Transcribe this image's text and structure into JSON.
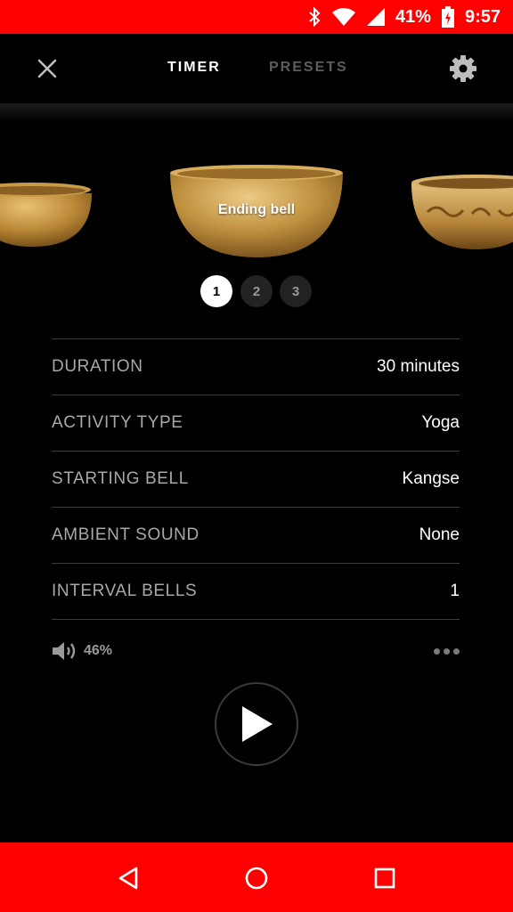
{
  "status_bar": {
    "battery_percent": "41%",
    "time": "9:57",
    "icons": [
      "bluetooth-icon",
      "wifi-icon",
      "cell-signal-icon",
      "battery-charging-icon"
    ]
  },
  "header": {
    "tabs": [
      {
        "label": "TIMER",
        "active": true
      },
      {
        "label": "PRESETS",
        "active": false
      }
    ],
    "icons": {
      "close": "close-icon",
      "settings": "gear-icon"
    }
  },
  "carousel": {
    "current_caption": "Ending bell",
    "pages": [
      "1",
      "2",
      "3"
    ],
    "active_page": "1"
  },
  "settings": [
    {
      "label": "DURATION",
      "value": "30 minutes"
    },
    {
      "label": "ACTIVITY TYPE",
      "value": "Yoga"
    },
    {
      "label": "STARTING BELL",
      "value": "Kangse"
    },
    {
      "label": "AMBIENT SOUND",
      "value": "None"
    },
    {
      "label": "INTERVAL BELLS",
      "value": "1"
    }
  ],
  "volume": {
    "percent": "46%",
    "icon": "speaker-icon"
  },
  "colors": {
    "status_bar": "#ff0000",
    "nav_bar": "#ff0000",
    "background": "#000000",
    "inactive_tab": "#5d5d5d"
  },
  "nav_bar": {
    "icons": [
      "back-icon",
      "home-icon",
      "recents-icon"
    ]
  }
}
